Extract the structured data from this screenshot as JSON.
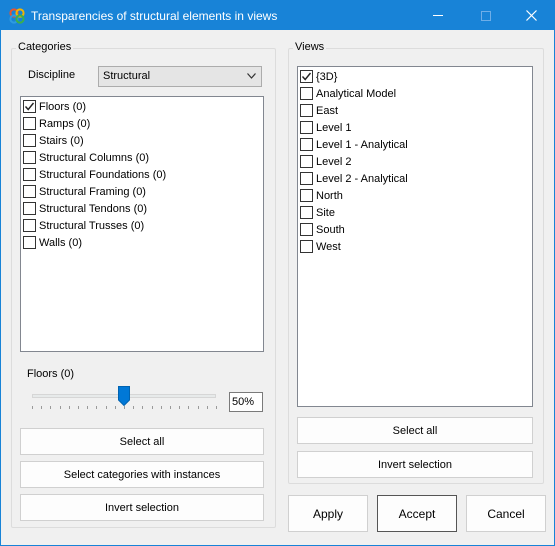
{
  "window": {
    "title": "Transparencies of structural elements in views"
  },
  "categories": {
    "group_title": "Categories",
    "discipline_label": "Discipline",
    "discipline_value": "Structural",
    "items": [
      {
        "label": "Floors (0)",
        "checked": true
      },
      {
        "label": "Ramps (0)",
        "checked": false
      },
      {
        "label": "Stairs (0)",
        "checked": false
      },
      {
        "label": "Structural Columns (0)",
        "checked": false
      },
      {
        "label": "Structural Foundations (0)",
        "checked": false
      },
      {
        "label": "Structural Framing (0)",
        "checked": false
      },
      {
        "label": "Structural Tendons (0)",
        "checked": false
      },
      {
        "label": "Structural Trusses (0)",
        "checked": false
      },
      {
        "label": "Walls (0)",
        "checked": false
      }
    ],
    "slider_label": "Floors (0)",
    "transparency_value": "50%",
    "transparency_fraction": 0.5,
    "select_all_label": "Select all",
    "select_with_instances_label": "Select categories with instances",
    "invert_selection_label": "Invert selection"
  },
  "views": {
    "group_title": "Views",
    "items": [
      {
        "label": "{3D}",
        "checked": true
      },
      {
        "label": "Analytical Model",
        "checked": false
      },
      {
        "label": "East",
        "checked": false
      },
      {
        "label": "Level 1",
        "checked": false
      },
      {
        "label": "Level 1 - Analytical",
        "checked": false
      },
      {
        "label": "Level 2",
        "checked": false
      },
      {
        "label": "Level 2 - Analytical",
        "checked": false
      },
      {
        "label": "North",
        "checked": false
      },
      {
        "label": "Site",
        "checked": false
      },
      {
        "label": "South",
        "checked": false
      },
      {
        "label": "West",
        "checked": false
      }
    ],
    "select_all_label": "Select all",
    "invert_selection_label": "Invert selection"
  },
  "footer": {
    "apply_label": "Apply",
    "accept_label": "Accept",
    "cancel_label": "Cancel"
  }
}
